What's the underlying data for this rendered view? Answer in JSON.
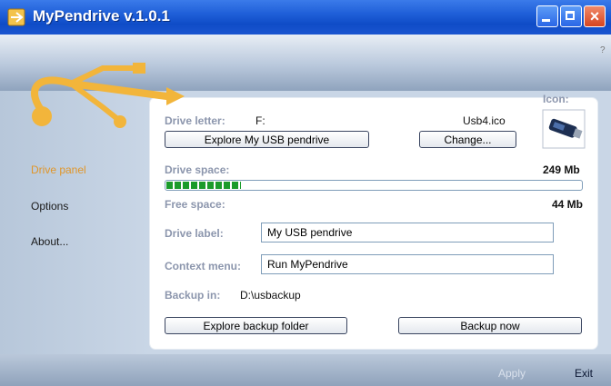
{
  "window": {
    "title": "MyPendrive v.1.0.1",
    "accent_title": "#1f5fd8",
    "help_label": "?"
  },
  "title_buttons": {
    "close_label": "×"
  },
  "sidebar": {
    "items": [
      {
        "label": "Drive panel",
        "active": true
      },
      {
        "label": "Options",
        "active": false
      },
      {
        "label": "About...",
        "active": false
      }
    ]
  },
  "drive": {
    "letter_label": "Drive letter:",
    "letter_value": "F:",
    "icon_label": "Icon:",
    "icon_file": "Usb4.ico",
    "explore_button": "Explore My USB pendrive",
    "change_button": "Change...",
    "space_label": "Drive space:",
    "space_value": "249 Mb",
    "used_fraction": 0.18,
    "progress_color": "#1a9b2a",
    "free_label": "Free space:",
    "free_value": "44 Mb",
    "drive_label_label": "Drive label:",
    "drive_label_value": "My USB pendrive",
    "context_menu_label": "Context menu:",
    "context_menu_value": "Run MyPendrive",
    "backup_label": "Backup in:",
    "backup_path": "D:\\usbackup",
    "explore_backup_button": "Explore backup folder",
    "backup_now_button": "Backup now"
  },
  "footer": {
    "apply_label": "Apply",
    "exit_label": "Exit"
  }
}
